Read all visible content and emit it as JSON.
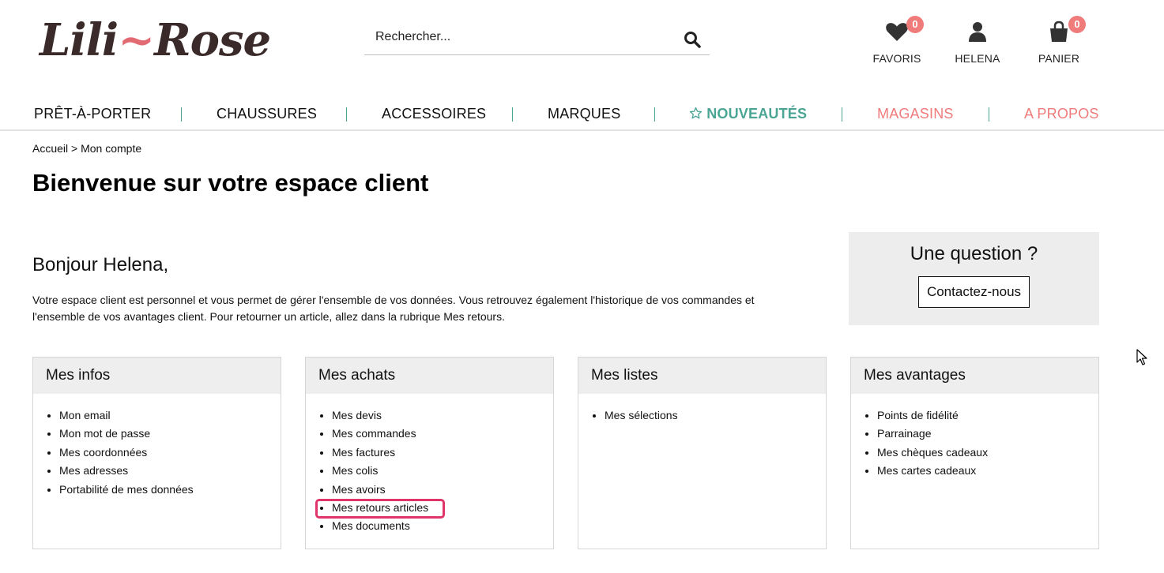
{
  "header": {
    "logo_text_a": "Lili",
    "logo_text_dash": "~",
    "logo_text_b": "Rose",
    "search_placeholder": "Rechercher...",
    "favoris": {
      "label": "FAVORIS",
      "count": "0"
    },
    "account": {
      "label": "HELENA"
    },
    "cart": {
      "label": "PANIER",
      "count": "0"
    }
  },
  "nav": {
    "items": [
      {
        "label": "PRÊT-À-PORTER"
      },
      {
        "label": "CHAUSSURES"
      },
      {
        "label": "ACCESSOIRES"
      },
      {
        "label": "MARQUES"
      },
      {
        "label": "NOUVEAUTÉS"
      },
      {
        "label": "MAGASINS"
      },
      {
        "label": "A PROPOS"
      }
    ]
  },
  "breadcrumb": {
    "home": "Accueil",
    "sep": ">",
    "current": "Mon compte"
  },
  "page_title": "Bienvenue sur votre espace client",
  "greeting": "Bonjour Helena,",
  "intro_line1": "Votre espace client est personnel et vous permet de gérer l'ensemble de vos données. Vous retrouvez également l'historique de vos commandes et",
  "intro_line2": "l'ensemble de vos avantages client. Pour retourner un article, allez dans la rubrique Mes retours.",
  "question": {
    "title": "Une question ?",
    "button": "Contactez-nous"
  },
  "panels": [
    {
      "title": "Mes infos",
      "items": [
        "Mon email",
        "Mon mot de passe",
        "Mes coordonnées",
        "Mes adresses",
        "Portabilité de mes données"
      ]
    },
    {
      "title": "Mes achats",
      "items": [
        "Mes devis",
        "Mes commandes",
        "Mes factures",
        "Mes colis",
        "Mes avoirs",
        "Mes retours articles",
        "Mes documents"
      ]
    },
    {
      "title": "Mes listes",
      "items": [
        "Mes sélections"
      ]
    },
    {
      "title": "Mes avantages",
      "items": [
        "Points de fidélité",
        "Parrainage",
        "Mes chèques cadeaux",
        "Mes cartes cadeaux"
      ]
    }
  ],
  "colors": {
    "accent_green": "#4aa595",
    "accent_pink": "#ef7b7b",
    "highlight": "#e0356b"
  }
}
